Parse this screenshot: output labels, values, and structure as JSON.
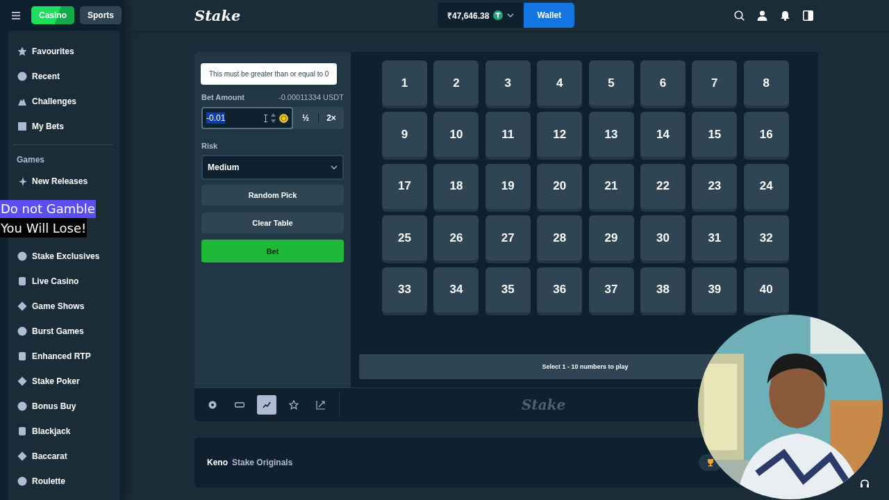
{
  "topbar": {
    "tabs": [
      {
        "label": "Casino",
        "selected": true
      },
      {
        "label": "Sports",
        "selected": false
      }
    ],
    "logo": "Stake",
    "balance": "₹47,646.38",
    "wallet_button": "Wallet"
  },
  "sidebar": {
    "top_items": [
      "Favourites",
      "Recent",
      "Challenges",
      "My Bets"
    ],
    "section_title": "Games",
    "games_before": [
      "New Releases"
    ],
    "games_after": [
      "Stake Exclusives",
      "Live Casino",
      "Game Shows",
      "Burst Games",
      "Enhanced RTP",
      "Stake Poker",
      "Bonus Buy",
      "Blackjack",
      "Baccarat",
      "Roulette"
    ]
  },
  "overlay_banner": [
    "Do not Gamble",
    "You Will Lose!"
  ],
  "bet_panel": {
    "tooltip": "This must be greater than or equal to 0",
    "bet_label": "Bet Amount",
    "bet_conversion": "-0.00011334 USDT",
    "bet_value": "-0.01",
    "half_button": "½",
    "double_button": "2×",
    "risk_label": "Risk",
    "risk_value": "Medium",
    "random_button": "Random Pick",
    "clear_button": "Clear Table",
    "bet_button": "Bet"
  },
  "board": {
    "tiles": [
      {
        "label": "1",
        "selected": false
      },
      {
        "label": "2",
        "selected": false
      },
      {
        "label": "3",
        "selected": false
      },
      {
        "label": "4",
        "selected": false
      },
      {
        "label": "5",
        "selected": false
      },
      {
        "label": "6",
        "selected": false
      },
      {
        "label": "7",
        "selected": false
      },
      {
        "label": "8",
        "selected": false
      },
      {
        "label": "9",
        "selected": false
      },
      {
        "label": "10",
        "selected": false
      },
      {
        "label": "11",
        "selected": false
      },
      {
        "label": "12",
        "selected": false
      },
      {
        "label": "13",
        "selected": false
      },
      {
        "label": "14",
        "selected": false
      },
      {
        "label": "15",
        "selected": false
      },
      {
        "label": "16",
        "selected": false
      },
      {
        "label": "17",
        "selected": false
      },
      {
        "label": "18",
        "selected": false
      },
      {
        "label": "19",
        "selected": false
      },
      {
        "label": "20",
        "selected": false
      },
      {
        "label": "21",
        "selected": false
      },
      {
        "label": "22",
        "selected": false
      },
      {
        "label": "23",
        "selected": false
      },
      {
        "label": "24",
        "selected": false
      },
      {
        "label": "25",
        "selected": false
      },
      {
        "label": "26",
        "selected": false
      },
      {
        "label": "27",
        "selected": false
      },
      {
        "label": "28",
        "selected": false
      },
      {
        "label": "29",
        "selected": false
      },
      {
        "label": "30",
        "selected": false
      },
      {
        "label": "31",
        "selected": false
      },
      {
        "label": "32",
        "selected": false
      },
      {
        "label": "33",
        "selected": false
      },
      {
        "label": "34",
        "selected": false
      },
      {
        "label": "35",
        "selected": false
      },
      {
        "label": "36",
        "selected": false
      },
      {
        "label": "37",
        "selected": false
      },
      {
        "label": "38",
        "selected": false
      },
      {
        "label": "39",
        "selected": false
      },
      {
        "label": "40",
        "selected": false
      }
    ],
    "message": "Select 1 - 10 numbers to play"
  },
  "toolbar": {
    "buttons": [
      {
        "selected": false
      },
      {
        "selected": false
      },
      {
        "selected": true
      },
      {
        "selected": false
      },
      {
        "selected": false
      }
    ],
    "watermark": "Stake"
  },
  "footer": {
    "title": "Keno",
    "subtitle": "Stake Originals"
  }
}
